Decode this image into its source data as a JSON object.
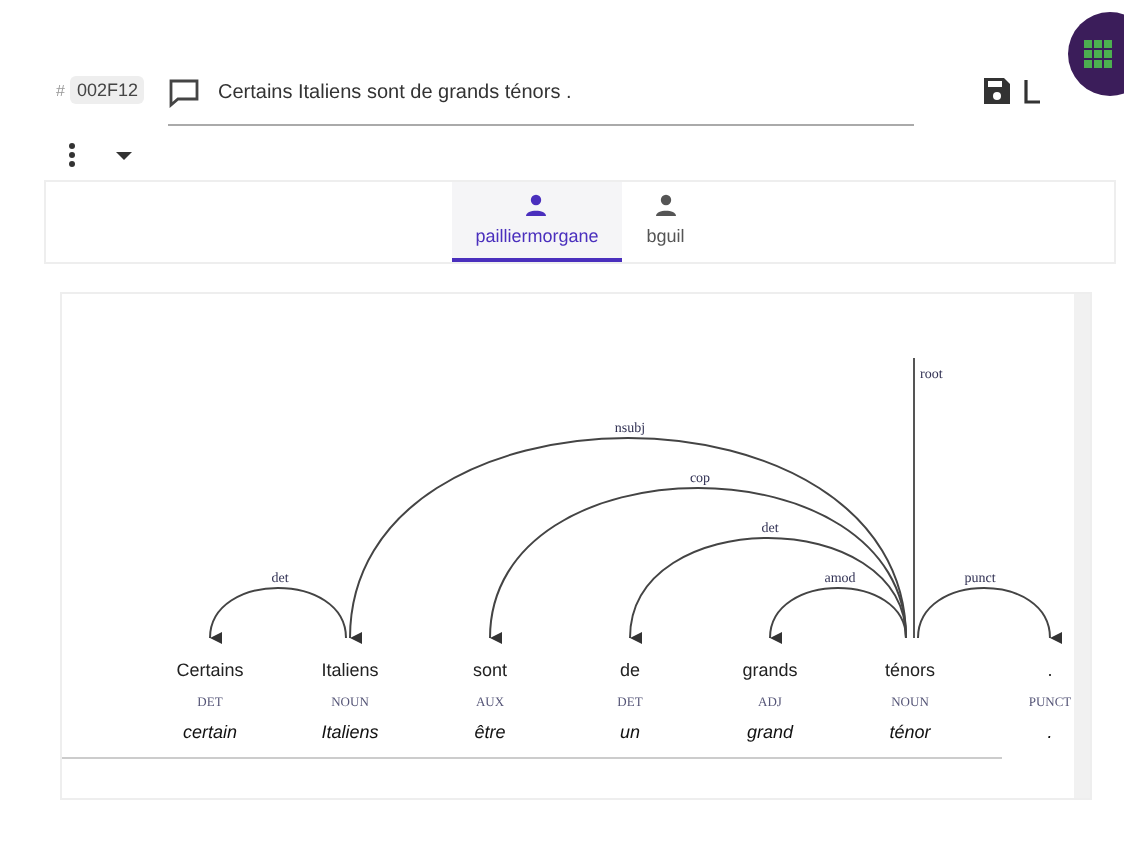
{
  "header": {
    "hash": "#",
    "sentence_id": "002F12",
    "text": "Certains Italiens sont de grands ténors ."
  },
  "tabs": [
    {
      "label": "pailliermorgane",
      "selected": true
    },
    {
      "label": "bguil",
      "selected": false
    }
  ],
  "tree": {
    "tokens": [
      {
        "form": "Certains",
        "upos": "DET",
        "lemma": "certain",
        "deprel": "det"
      },
      {
        "form": "Italiens",
        "upos": "NOUN",
        "lemma": "Italiens",
        "deprel": "nsubj"
      },
      {
        "form": "sont",
        "upos": "AUX",
        "lemma": "être",
        "deprel": "cop"
      },
      {
        "form": "de",
        "upos": "DET",
        "lemma": "un",
        "deprel": "det"
      },
      {
        "form": "grands",
        "upos": "ADJ",
        "lemma": "grand",
        "deprel": "amod"
      },
      {
        "form": "ténors",
        "upos": "NOUN",
        "lemma": "ténor",
        "deprel": "root"
      },
      {
        "form": ".",
        "upos": "PUNCT",
        "lemma": ".",
        "deprel": "punct"
      }
    ]
  }
}
